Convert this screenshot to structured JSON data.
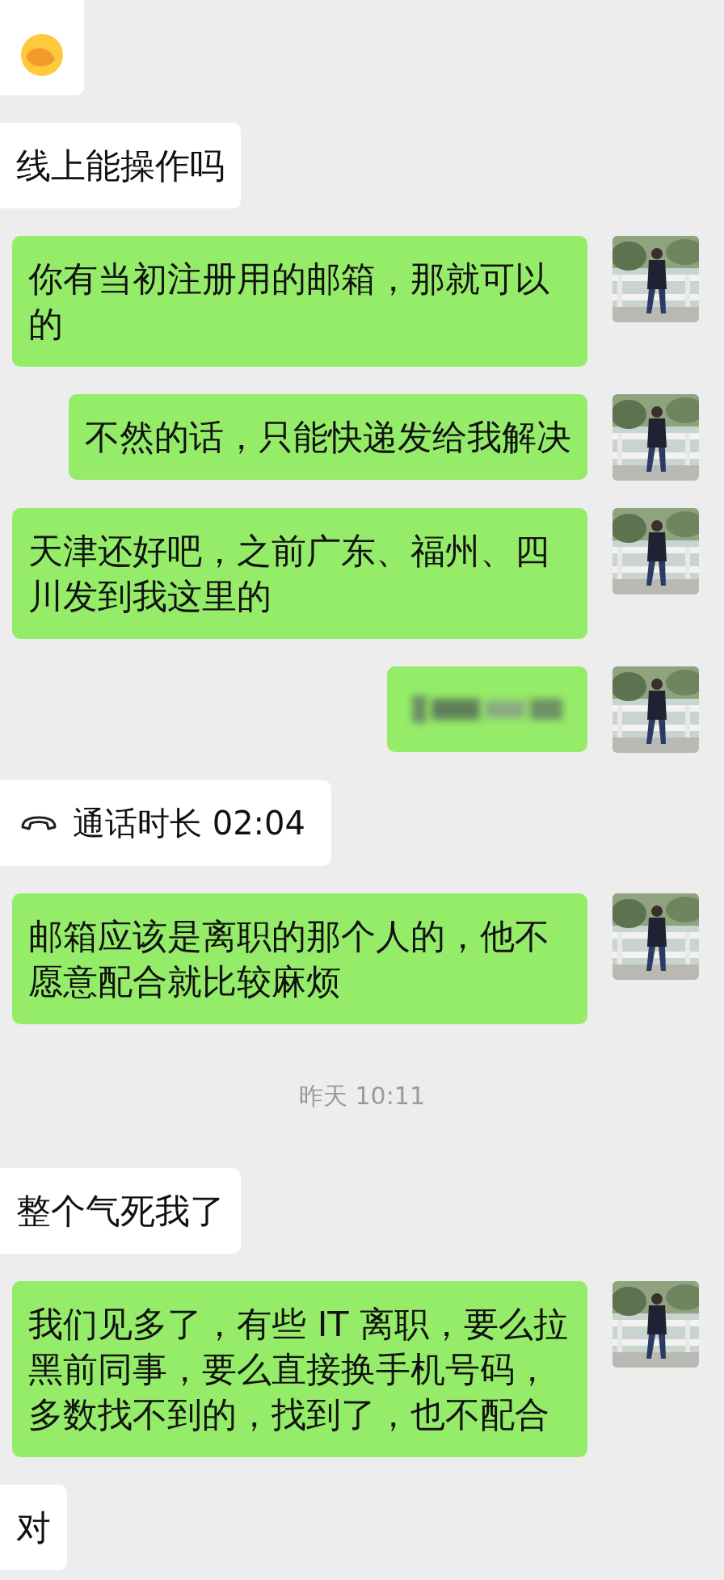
{
  "messages": [
    {
      "kind": "emoji",
      "sent": false
    },
    {
      "kind": "text",
      "sent": false,
      "text": "线上能操作吗"
    },
    {
      "kind": "text",
      "sent": true,
      "text": "你有当初注册用的邮箱，那就可以的"
    },
    {
      "kind": "text",
      "sent": true,
      "text": "不然的话，只能快递发给我解决"
    },
    {
      "kind": "text",
      "sent": true,
      "text": "天津还好吧，之前广东、福州、四川发到我这里的"
    },
    {
      "kind": "blurred",
      "sent": true
    },
    {
      "kind": "call",
      "sent": false,
      "text": "通话时长 02:04"
    },
    {
      "kind": "text",
      "sent": true,
      "text": "邮箱应该是离职的那个人的，他不愿意配合就比较麻烦"
    },
    {
      "kind": "time",
      "text": "昨天 10:11"
    },
    {
      "kind": "text",
      "sent": false,
      "text": "整个气死我了"
    },
    {
      "kind": "text",
      "sent": true,
      "text": "我们见多了，有些 IT 离职，要么拉黑前同事，要么直接换手机号码，多数找不到的，找到了，也不配合"
    },
    {
      "kind": "text",
      "sent": false,
      "text": "对"
    }
  ]
}
